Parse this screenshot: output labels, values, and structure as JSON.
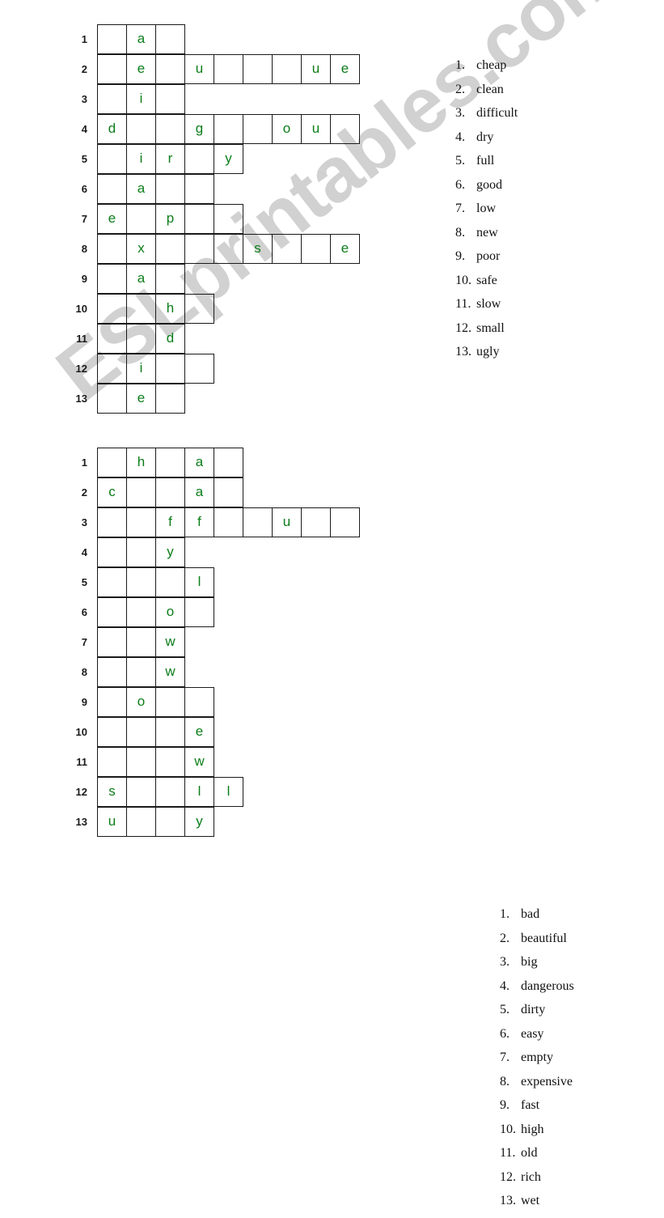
{
  "document": {
    "type": "esl-worksheet",
    "title": "Opposites crossword-style letter grids",
    "watermark": "ESLprintables.com",
    "letter_color": "#0a7d18",
    "grid_line_color": "#1a1a1a",
    "text_color": "#111111"
  },
  "puzzles": [
    {
      "id": "puzzle-1",
      "grid": {
        "rows": [
          {
            "number": "1",
            "length": 3,
            "letters": {
              "2": "a"
            }
          },
          {
            "number": "2",
            "length": 9,
            "letters": {
              "2": "e",
              "4": "u",
              "8": "u",
              "9": "e"
            }
          },
          {
            "number": "3",
            "length": 3,
            "letters": {
              "2": "i"
            }
          },
          {
            "number": "4",
            "length": 9,
            "letters": {
              "1": "d",
              "4": "g",
              "7": "o",
              "8": "u"
            }
          },
          {
            "number": "5",
            "length": 5,
            "letters": {
              "2": "i",
              "3": "r",
              "5": "y"
            }
          },
          {
            "number": "6",
            "length": 4,
            "letters": {
              "2": "a"
            }
          },
          {
            "number": "7",
            "length": 5,
            "letters": {
              "1": "e",
              "3": "p"
            }
          },
          {
            "number": "8",
            "length": 9,
            "letters": {
              "2": "x",
              "6": "s",
              "9": "e"
            }
          },
          {
            "number": "9",
            "length": 3,
            "letters": {
              "2": "a"
            }
          },
          {
            "number": "10",
            "length": 4,
            "letters": {
              "3": "h"
            }
          },
          {
            "number": "11",
            "length": 3,
            "letters": {
              "3": "d"
            }
          },
          {
            "number": "12",
            "length": 4,
            "letters": {
              "2": "i"
            }
          },
          {
            "number": "13",
            "length": 3,
            "letters": {
              "2": "e"
            }
          }
        ]
      },
      "word_list": [
        {
          "num": "1.",
          "word": "cheap"
        },
        {
          "num": "2.",
          "word": "clean"
        },
        {
          "num": "3.",
          "word": "difficult"
        },
        {
          "num": "4.",
          "word": "dry"
        },
        {
          "num": "5.",
          "word": "full"
        },
        {
          "num": "6.",
          "word": "good"
        },
        {
          "num": "7.",
          "word": "low"
        },
        {
          "num": "8.",
          "word": "new"
        },
        {
          "num": "9.",
          "word": "poor"
        },
        {
          "num": "10.",
          "word": "safe"
        },
        {
          "num": "11.",
          "word": "slow"
        },
        {
          "num": "12.",
          "word": "small"
        },
        {
          "num": "13.",
          "word": "ugly"
        }
      ]
    },
    {
      "id": "puzzle-2",
      "grid": {
        "rows": [
          {
            "number": "1",
            "length": 5,
            "letters": {
              "2": "h",
              "4": "a"
            }
          },
          {
            "number": "2",
            "length": 5,
            "letters": {
              "1": "c",
              "4": "a"
            }
          },
          {
            "number": "3",
            "length": 9,
            "letters": {
              "3": "f",
              "4": "f",
              "7": "u"
            }
          },
          {
            "number": "4",
            "length": 3,
            "letters": {
              "3": "y"
            }
          },
          {
            "number": "5",
            "length": 4,
            "letters": {
              "4": "l"
            }
          },
          {
            "number": "6",
            "length": 4,
            "letters": {
              "3": "o"
            }
          },
          {
            "number": "7",
            "length": 3,
            "letters": {
              "3": "w"
            }
          },
          {
            "number": "8",
            "length": 3,
            "letters": {
              "3": "w"
            }
          },
          {
            "number": "9",
            "length": 4,
            "letters": {
              "2": "o"
            }
          },
          {
            "number": "10",
            "length": 4,
            "letters": {
              "4": "e"
            }
          },
          {
            "number": "11",
            "length": 4,
            "letters": {
              "4": "w"
            }
          },
          {
            "number": "12",
            "length": 5,
            "letters": {
              "1": "s",
              "4": "l",
              "5": "l"
            }
          },
          {
            "number": "13",
            "length": 4,
            "letters": {
              "1": "u",
              "4": "y"
            }
          }
        ]
      },
      "word_list": [
        {
          "num": "1.",
          "word": "bad"
        },
        {
          "num": "2.",
          "word": "beautiful"
        },
        {
          "num": "3.",
          "word": "big"
        },
        {
          "num": "4.",
          "word": "dangerous"
        },
        {
          "num": "5.",
          "word": "dirty"
        },
        {
          "num": "6.",
          "word": "easy"
        },
        {
          "num": "7.",
          "word": "empty"
        },
        {
          "num": "8.",
          "word": "expensive"
        },
        {
          "num": "9.",
          "word": "fast"
        },
        {
          "num": "10.",
          "word": "high"
        },
        {
          "num": "11.",
          "word": "old"
        },
        {
          "num": "12.",
          "word": "rich"
        },
        {
          "num": "13.",
          "word": "wet"
        }
      ]
    }
  ]
}
